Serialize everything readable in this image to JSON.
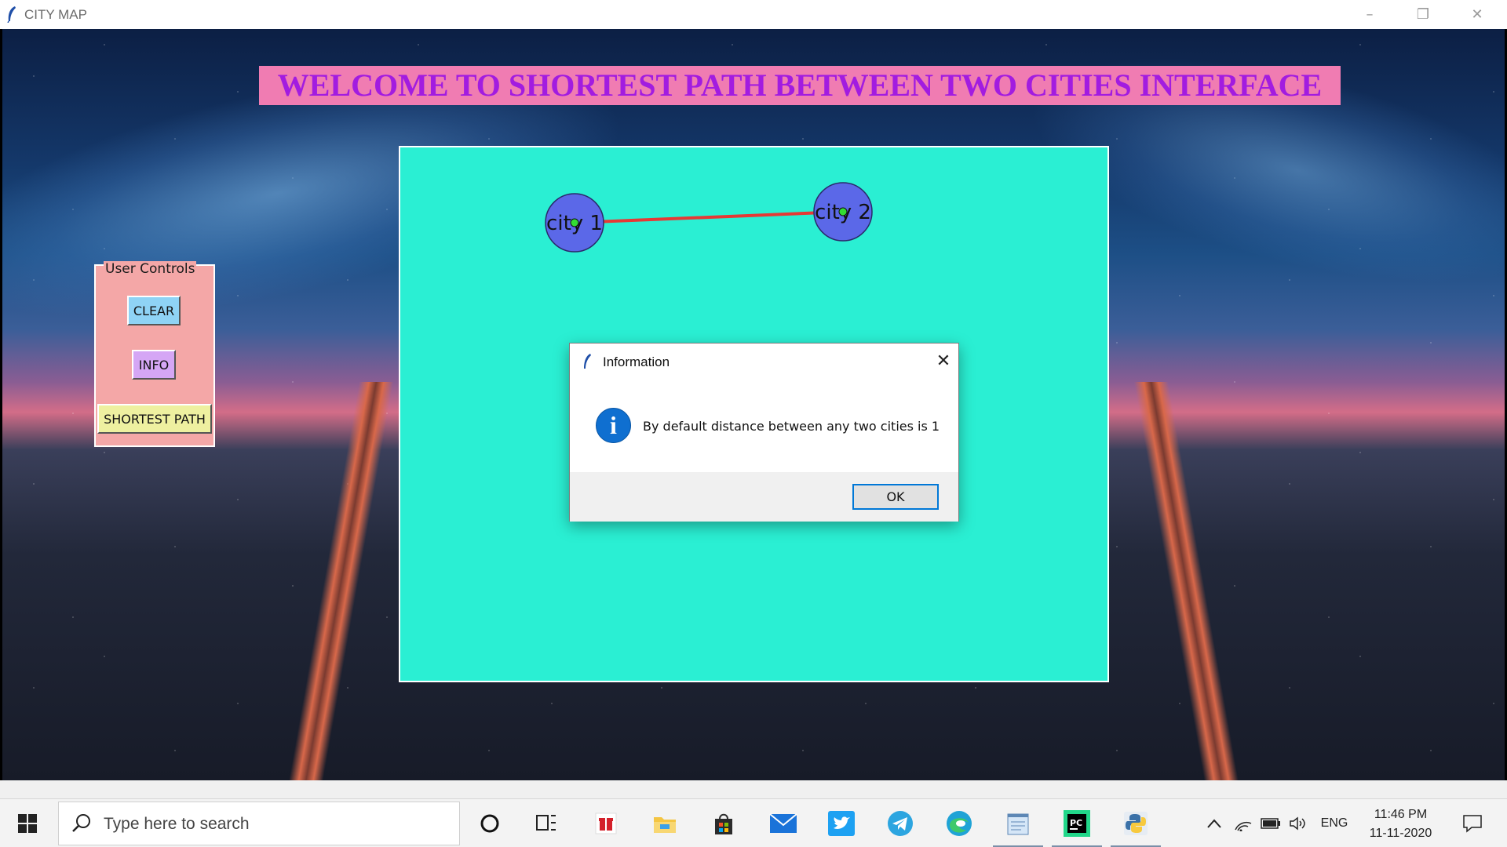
{
  "window": {
    "title": "CITY MAP",
    "controls": {
      "minimize": "–",
      "restore": "❐",
      "close": "✕"
    }
  },
  "header": {
    "welcome": "WELCOME TO SHORTEST PATH BETWEEN TWO CITIES INTERFACE"
  },
  "user_controls": {
    "legend": "User Controls",
    "clear_label": "CLEAR",
    "info_label": "INFO",
    "shortest_path_label": "SHORTEST PATH"
  },
  "map": {
    "cities": [
      {
        "label": "city 1"
      },
      {
        "label": "city 2"
      }
    ],
    "edge_color": "#e53935",
    "city_color": "#5b68e8",
    "canvas_color": "#2aefd3"
  },
  "dialog": {
    "title": "Information",
    "message": "By default distance between any two cities is 1",
    "ok_label": "OK",
    "icon": "info-icon"
  },
  "taskbar": {
    "search_placeholder": "Type here to search",
    "apps": [
      "cortana-icon",
      "task-view-icon",
      "gift-icon",
      "file-explorer-icon",
      "store-icon",
      "mail-icon",
      "twitter-icon",
      "telegram-icon",
      "edge-icon",
      "notepad-icon",
      "pycharm-icon",
      "python-icon"
    ],
    "language": "ENG",
    "time": "11:46 PM",
    "date": "11-11-2020"
  }
}
